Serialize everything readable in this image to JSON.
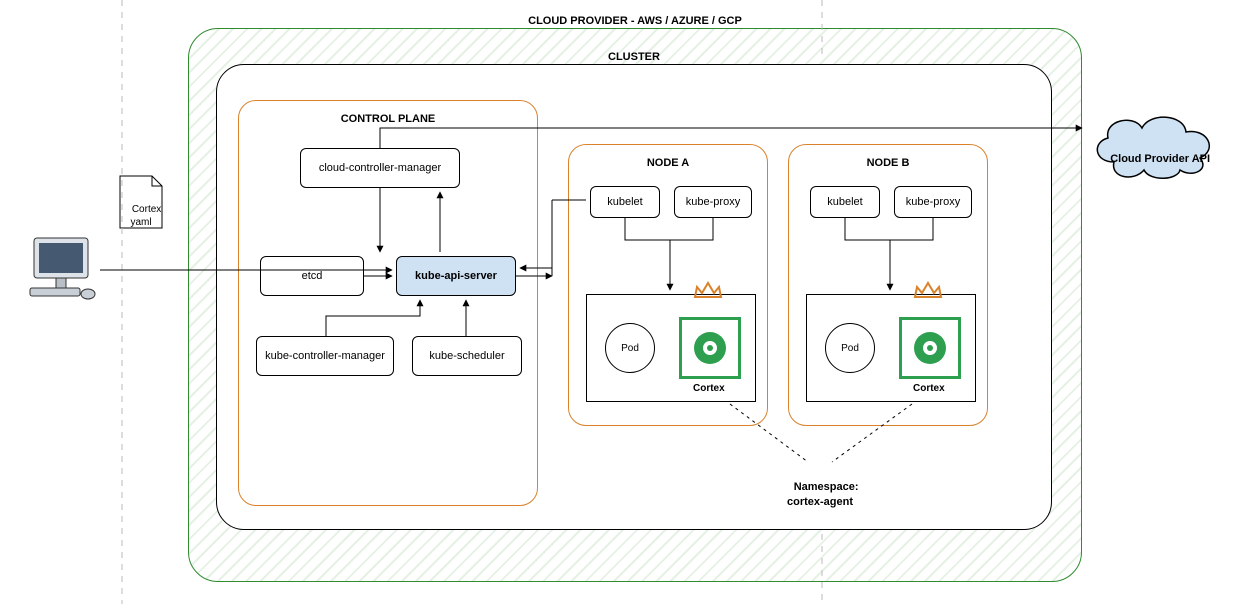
{
  "titles": {
    "cloud_provider": "CLOUD PROVIDER - AWS / AZURE / GCP",
    "cluster": "CLUSTER",
    "control_plane": "CONTROL PLANE",
    "node_a": "NODE A",
    "node_b": "NODE B"
  },
  "left": {
    "computer": "computer-icon",
    "yaml_file": "Cortex\nyaml"
  },
  "control_plane": {
    "ccm": "cloud-controller-manager",
    "etcd": "etcd",
    "api": "kube-api-server",
    "kcm": "kube-controller-manager",
    "sched": "kube-scheduler"
  },
  "node": {
    "kubelet": "kubelet",
    "kube_proxy": "kube-proxy",
    "pod": "Pod",
    "cortex": "Cortex"
  },
  "cloud_cloud": "Cloud Provider API",
  "namespace": "Namespace:\ncortex-agent"
}
